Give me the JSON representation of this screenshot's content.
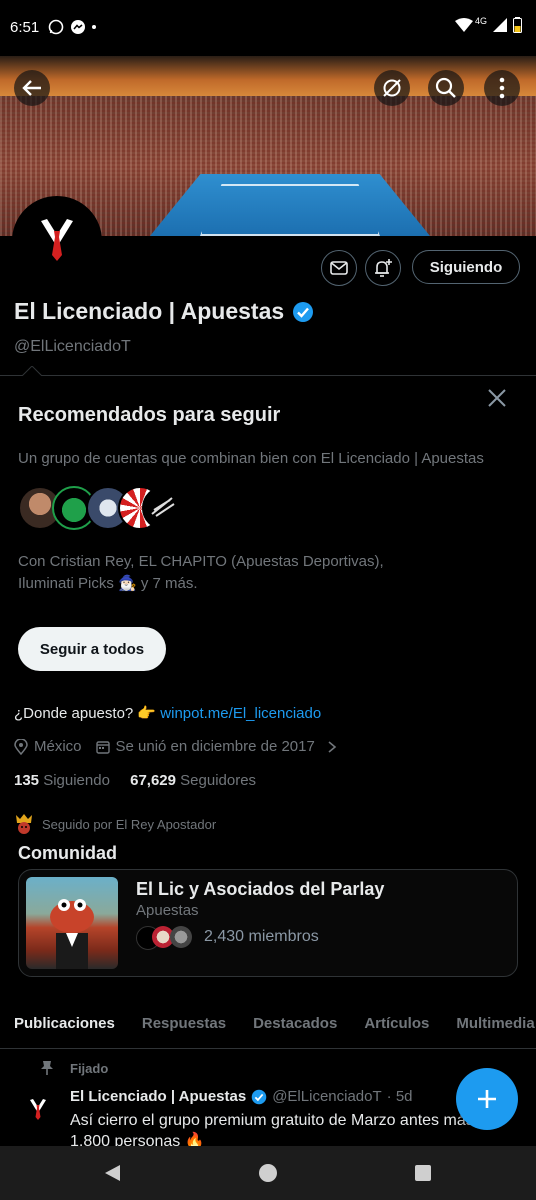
{
  "status_bar": {
    "time": "6:51",
    "network": "4G"
  },
  "banner": {
    "icons": [
      "back-arrow-icon",
      "topic-slash-icon",
      "search-icon",
      "more-vertical-icon"
    ]
  },
  "profile": {
    "name": "El Licenciado | Apuestas",
    "handle": "@ElLicenciadoT",
    "follow_button": "Siguiendo",
    "verified": true
  },
  "recommended": {
    "title": "Recomendados para seguir",
    "subtitle": "Un grupo de cuentas que combinan bien con El Licenciado | Apuestas",
    "with_text_line1": "Con Cristian Rey, EL CHAPITO (Apuestas Deportivas),",
    "with_text_line2": "Iluminati Picks 🧙🏻‍♂️ y 7 más.",
    "follow_all": "Seguir a todos"
  },
  "bio": {
    "text": "¿Donde apuesto? 👉",
    "link": "winpot.me/El_licenciado"
  },
  "meta": {
    "location": "México",
    "joined": "Se unió en diciembre de 2017"
  },
  "counts": {
    "following_num": "135",
    "following_label": "Siguiendo",
    "followers_num": "67,629",
    "followers_label": "Seguidores"
  },
  "followed_by": "Seguido por El Rey Apostador",
  "community": {
    "section_title": "Comunidad",
    "name": "El Lic y Asociados del Parlay",
    "category": "Apuestas",
    "members": "2,430 miembros"
  },
  "tabs": [
    "Publicaciones",
    "Respuestas",
    "Destacados",
    "Artículos",
    "Multimedia"
  ],
  "post": {
    "pinned_label": "Fijado",
    "author": "El Licenciado | Apuestas",
    "handle": "@ElLicenciadoT",
    "time": "· 5d",
    "text": "Así cierro el grupo premium gratuito de Marzo antes más de 1,800 personas 🔥"
  },
  "colors": {
    "accent": "#1d9bf0",
    "background": "#000000",
    "secondary_text": "#71767b"
  }
}
